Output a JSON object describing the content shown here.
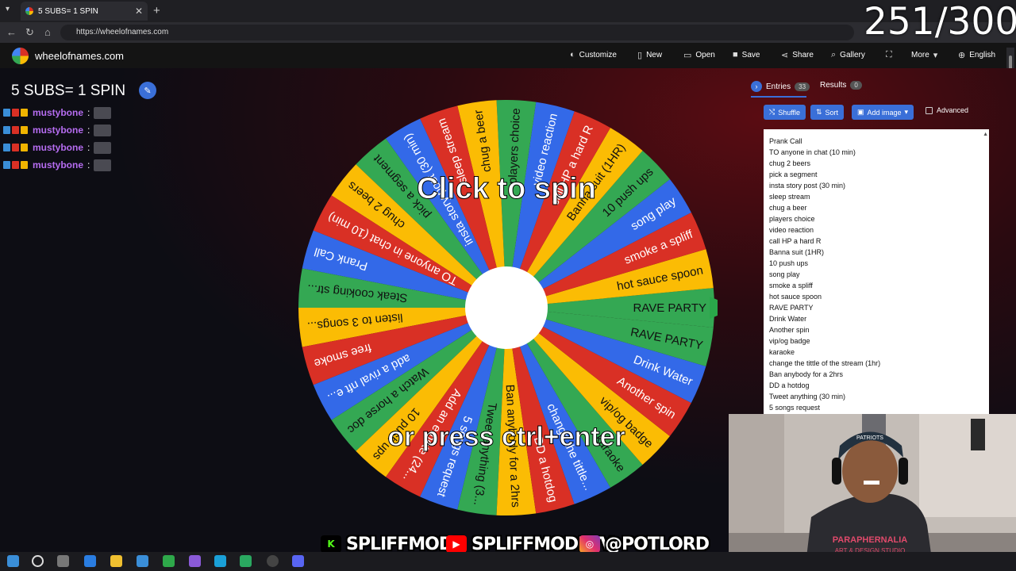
{
  "browser": {
    "tab_title": "5 SUBS= 1 SPIN",
    "tab_close": "✕",
    "new_tab": "+",
    "url": "https://wheelofnames.com"
  },
  "header": {
    "logo_text": "wheelofnames.com",
    "buttons": [
      {
        "label": "Customize",
        "icon": "palette-icon"
      },
      {
        "label": "New",
        "icon": "new-file-icon"
      },
      {
        "label": "Open",
        "icon": "folder-icon"
      },
      {
        "label": "Save",
        "icon": "save-icon"
      },
      {
        "label": "Share",
        "icon": "share-icon"
      },
      {
        "label": "Gallery",
        "icon": "search-icon"
      },
      {
        "label": "",
        "icon": "fullscreen-icon"
      },
      {
        "label": "More",
        "icon": "chevron-down-icon"
      },
      {
        "label": "English",
        "icon": "globe-icon"
      }
    ]
  },
  "wheel": {
    "title": "5 SUBS= 1 SPIN",
    "spin_text_top": "Click to spin",
    "spin_text_bottom": "or press ctrl+enter",
    "segments": [
      "RAVE PARTY",
      "hot sauce spoon",
      "smoke a spliff",
      "song play",
      "10 push ups",
      "Banna suit (1HR)",
      "call HP a hard R",
      "video reaction",
      "players choice",
      "chug a beer",
      "sleep stream",
      "insta story post (30 min)",
      "pick a segment",
      "chug 2 beers",
      "TO anyone in chat (10 min)",
      "Prank Call",
      "Steak cooking str...",
      "listen to 3 songs...",
      "free smoke",
      "add a rival nft e...",
      "Watch a horse doc",
      "10 push ups",
      "Add an emote (24...",
      "5 songs request",
      "Tweet anything (3...",
      "Ban anybody for a 2hrs",
      "DD a hotdog",
      "change the tittle...",
      "karaoke",
      "vip/og badge",
      "Another spin",
      "Drink Water",
      "RAVE PARTY"
    ],
    "colors": [
      "#34a853",
      "#fbbc04",
      "#d93025",
      "#3369e8"
    ]
  },
  "chat": {
    "lines": [
      {
        "name": "mustybone",
        "sep": ":"
      },
      {
        "name": "mustybone",
        "sep": ":"
      },
      {
        "name": "mustybone",
        "sep": ":"
      },
      {
        "name": "mustybone",
        "sep": ":"
      }
    ]
  },
  "panel": {
    "entries_tab": "Entries",
    "entries_count": "33",
    "results_tab": "Results",
    "results_count": "0",
    "shuffle": "Shuffle",
    "sort": "Sort",
    "add_image": "Add image",
    "advanced": "Advanced",
    "entries": [
      "Prank Call",
      "TO anyone in chat (10 min)",
      "chug 2 beers",
      "pick a segment",
      "insta story post (30 min)",
      "sleep stream",
      "chug a beer",
      "players choice",
      "video reaction",
      "call HP a hard R",
      "Banna suit (1HR)",
      "10 push ups",
      "song play",
      "smoke a spliff",
      "hot sauce spoon",
      "RAVE PARTY",
      "Drink Water",
      "Another spin",
      "vip/og badge",
      "karaoke",
      "change the tittle of the stream (1hr)",
      "Ban anybody for a 2hrs",
      "DD a hotdog",
      "Tweet anything (30 min)",
      "5 songs request"
    ]
  },
  "overlay": {
    "counter": "251/300",
    "kick_handle": "SPLIFFMODE",
    "youtube_handle": "SPLIFFMODETV",
    "instagram_handle": "@POTLORD",
    "hoodie_text": "PARAPHERNALIA",
    "hoodie_sub": "ART & DESIGN STUDIO",
    "cap_text": "PATRIOTS"
  }
}
